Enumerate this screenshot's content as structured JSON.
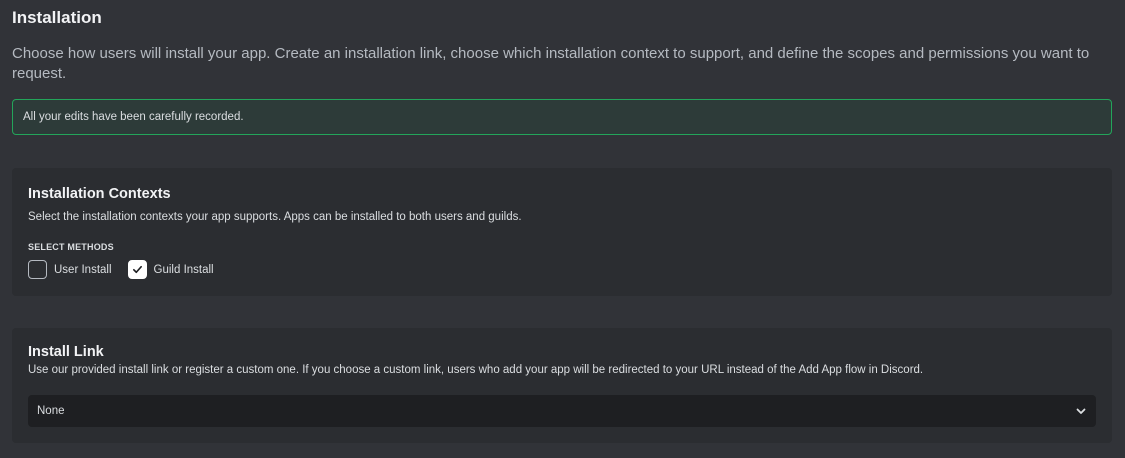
{
  "page": {
    "title": "Installation",
    "description": "Choose how users will install your app. Create an installation link, choose which installation context to support, and define the scopes and permissions you want to request."
  },
  "notice": {
    "text": "All your edits have been carefully recorded."
  },
  "installation_contexts": {
    "title": "Installation Contexts",
    "description": "Select the installation contexts your app supports. Apps can be installed to both users and guilds.",
    "section_label": "SELECT METHODS",
    "methods": [
      {
        "label": "User Install",
        "checked": false
      },
      {
        "label": "Guild Install",
        "checked": true
      }
    ]
  },
  "install_link": {
    "title": "Install Link",
    "description": "Use our provided install link or register a custom one. If you choose a custom link, users who add your app will be redirected to your URL instead of the Add App flow in Discord.",
    "selected_value": "None"
  },
  "colors": {
    "background": "#313338",
    "card": "#2b2d31",
    "input": "#1e1f22",
    "success_border": "#23a55a"
  },
  "icons": {
    "checkmark": "checkmark-icon",
    "dropdown": "chevron-down-icon"
  }
}
